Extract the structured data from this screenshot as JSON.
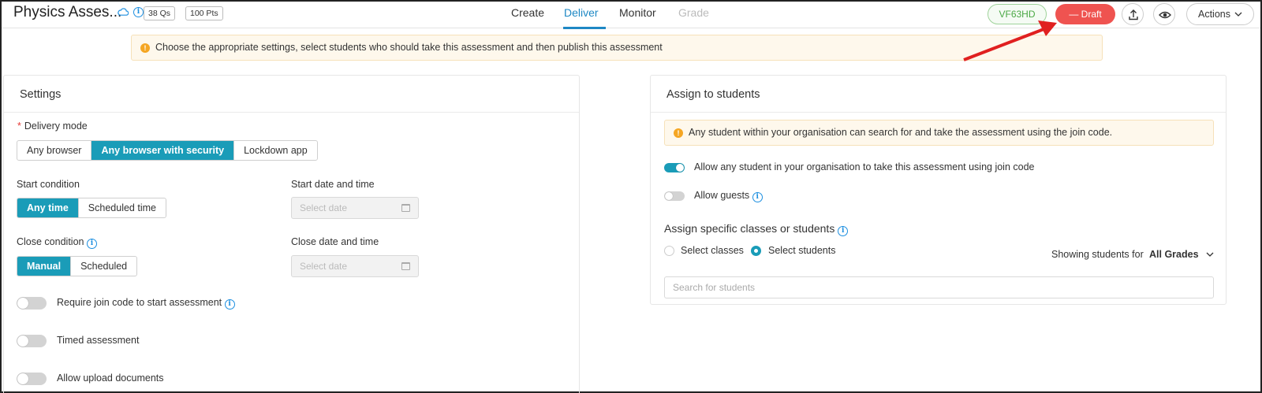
{
  "header": {
    "title": "Physics Asses...",
    "questions_chip": "38 Qs",
    "points_chip": "100 Pts",
    "tabs": [
      {
        "label": "Create",
        "state": "default"
      },
      {
        "label": "Deliver",
        "state": "active"
      },
      {
        "label": "Monitor",
        "state": "default"
      },
      {
        "label": "Grade",
        "state": "disabled"
      }
    ],
    "join_code": "VF63HD",
    "draft_label": "Draft",
    "actions_label": "Actions",
    "icons": [
      "cloud-icon",
      "info-icon",
      "upload-icon",
      "eye-icon",
      "chevron-down-icon"
    ]
  },
  "top_notice": "Choose the appropriate settings, select students who should take this assessment and then publish this assessment",
  "settings": {
    "title": "Settings",
    "delivery_mode": {
      "label": "Delivery mode",
      "options": [
        "Any browser",
        "Any browser with security",
        "Lockdown app"
      ],
      "selected": "Any browser with security"
    },
    "start_condition": {
      "label": "Start condition",
      "options": [
        "Any time",
        "Scheduled time"
      ],
      "selected": "Any time"
    },
    "start_datetime": {
      "label": "Start date and time",
      "placeholder": "Select date"
    },
    "close_condition": {
      "label": "Close condition",
      "options": [
        "Manual",
        "Scheduled"
      ],
      "selected": "Manual"
    },
    "close_datetime": {
      "label": "Close date and time",
      "placeholder": "Select date"
    },
    "toggles": [
      {
        "label": "Require join code to start assessment",
        "on": false
      },
      {
        "label": "Timed assessment",
        "on": false
      },
      {
        "label": "Allow upload documents",
        "on": false
      }
    ]
  },
  "assign": {
    "title": "Assign to students",
    "notice": "Any student within your organisation can search for and take the assessment using the join code.",
    "toggles": [
      {
        "label": "Allow any student in your organisation to take this assessment using join code",
        "on": true
      },
      {
        "label": "Allow guests",
        "on": false
      }
    ],
    "specific_title": "Assign specific classes or students",
    "radios": [
      {
        "label": "Select classes",
        "selected": false
      },
      {
        "label": "Select students",
        "selected": true
      }
    ],
    "showing_label": "Showing students for",
    "grade_filter": "All Grades",
    "search_placeholder": "Search for students"
  },
  "colors": {
    "accent": "#1a9cb8",
    "tab_active": "#1e88c4",
    "draft": "#ef5350",
    "join_code": "#4aa844",
    "warning": "#f5a623",
    "annotation_arrow": "#e02020"
  }
}
